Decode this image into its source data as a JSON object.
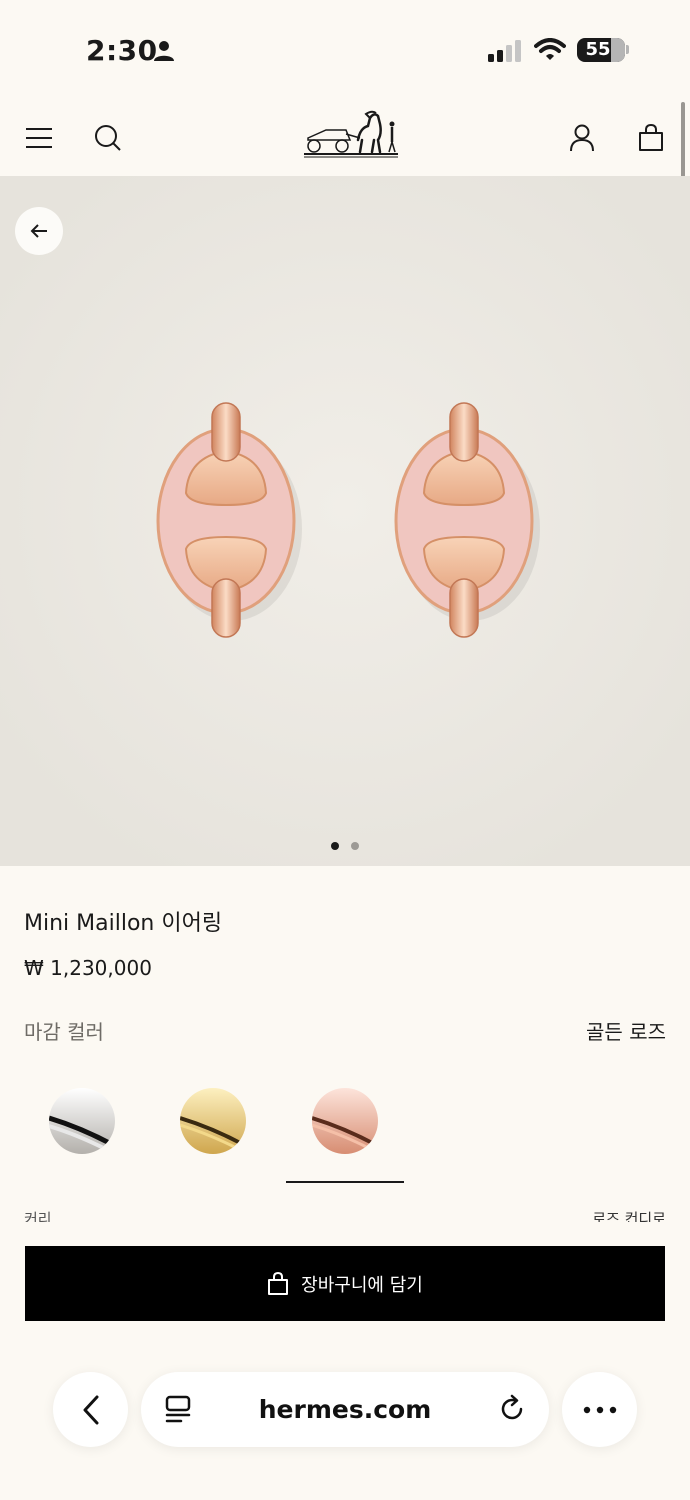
{
  "status_bar": {
    "time": "2:30",
    "battery": "55"
  },
  "header": {
    "icons": [
      "menu-icon",
      "search-icon",
      "hermes-logo",
      "account-icon",
      "shopping-bag-icon"
    ]
  },
  "gallery": {
    "pages": 2,
    "active_page": 1
  },
  "product": {
    "name": "Mini Maillon 이어링",
    "price": "₩ 1,230,000",
    "finish_label": "마감 컬러",
    "finish_value": "골든 로즈",
    "swatches": [
      "silver",
      "gold",
      "rose gold"
    ],
    "selected_swatch": "rose gold",
    "size_label": "커리",
    "size_value": "로즈 컨디로"
  },
  "cart": {
    "label": "장바구니에 담기"
  },
  "browser": {
    "domain": "hermes.com"
  },
  "colors": {
    "background": "#fcf9f3",
    "gallery_bg": "#e8e5de",
    "button_bg": "#000000",
    "enamel_pink": "#f0c6c0",
    "rose_gold": "#e3a27c"
  }
}
